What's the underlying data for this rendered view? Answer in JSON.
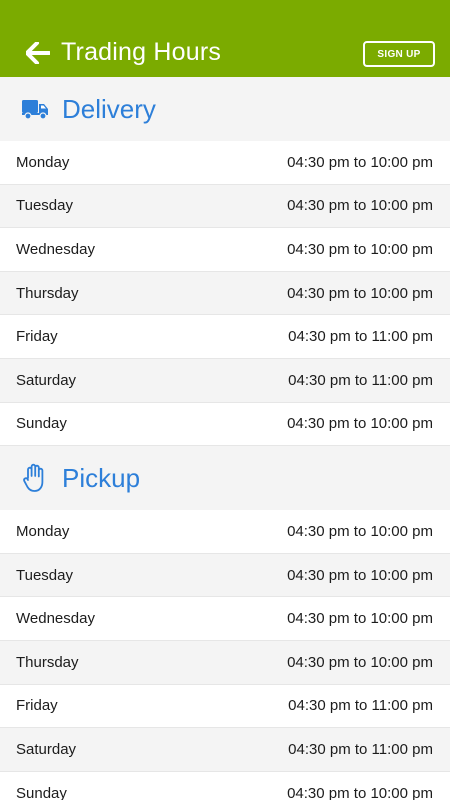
{
  "header": {
    "title": "Trading Hours",
    "signup_label": "SIGN UP",
    "back_icon": "back-arrow-icon",
    "bg_color": "#7bab00"
  },
  "delivery": {
    "title": "Delivery",
    "icon": "truck-icon",
    "rows": [
      {
        "day": "Monday",
        "hours": "04:30 pm to 10:00 pm"
      },
      {
        "day": "Tuesday",
        "hours": "04:30 pm to 10:00 pm"
      },
      {
        "day": "Wednesday",
        "hours": "04:30 pm to 10:00 pm"
      },
      {
        "day": "Thursday",
        "hours": "04:30 pm to 10:00 pm"
      },
      {
        "day": "Friday",
        "hours": "04:30 pm to 11:00 pm"
      },
      {
        "day": "Saturday",
        "hours": "04:30 pm to 11:00 pm"
      },
      {
        "day": "Sunday",
        "hours": "04:30 pm to 10:00 pm"
      }
    ]
  },
  "pickup": {
    "title": "Pickup",
    "icon": "hand-icon",
    "rows": [
      {
        "day": "Monday",
        "hours": "04:30 pm to 10:00 pm"
      },
      {
        "day": "Tuesday",
        "hours": "04:30 pm to 10:00 pm"
      },
      {
        "day": "Wednesday",
        "hours": "04:30 pm to 10:00 pm"
      },
      {
        "day": "Thursday",
        "hours": "04:30 pm to 10:00 pm"
      },
      {
        "day": "Friday",
        "hours": "04:30 pm to 11:00 pm"
      },
      {
        "day": "Saturday",
        "hours": "04:30 pm to 11:00 pm"
      },
      {
        "day": "Sunday",
        "hours": "04:30 pm to 10:00 pm"
      }
    ]
  },
  "accent_color": "#2d7fd9"
}
